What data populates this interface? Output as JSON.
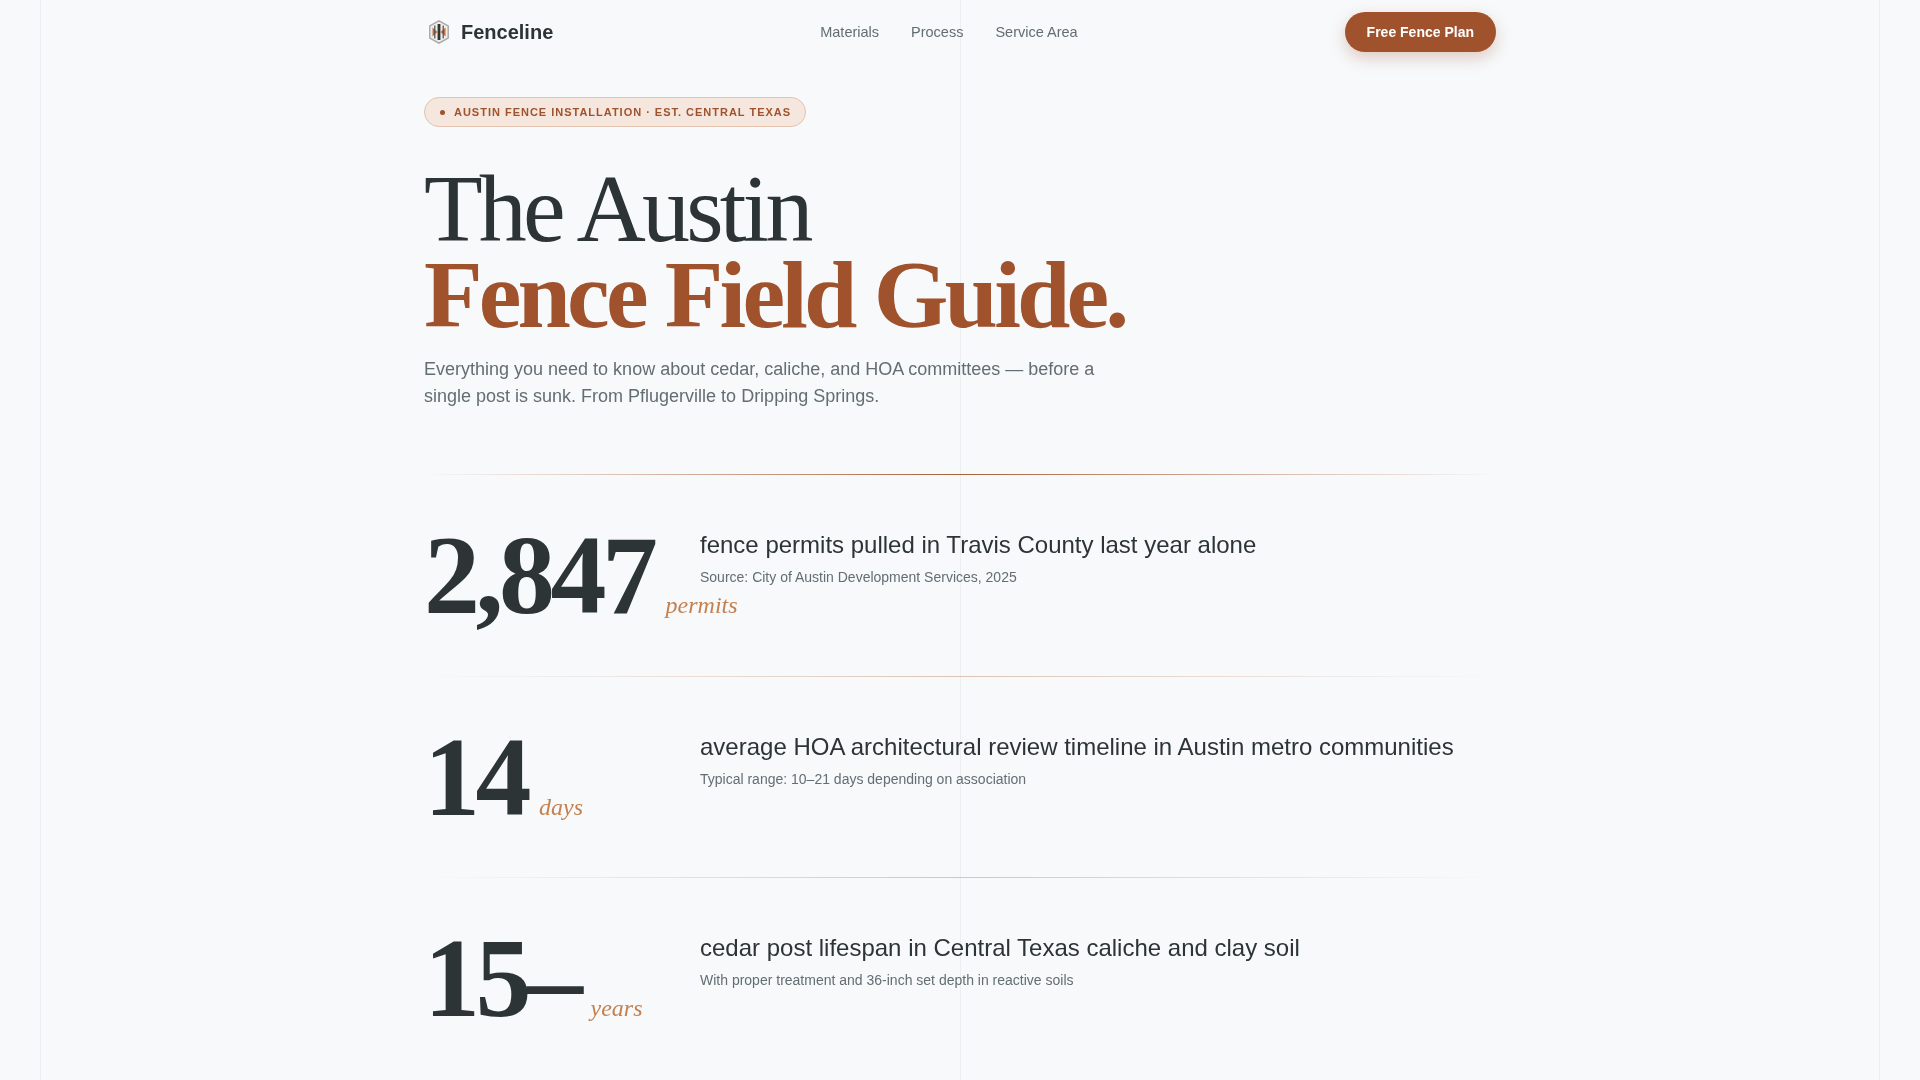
{
  "header": {
    "brand": "Fenceline",
    "nav": [
      "Materials",
      "Process",
      "Service Area"
    ],
    "cta": "Free Fence Plan"
  },
  "hero": {
    "badge": "AUSTIN FENCE INSTALLATION · EST. CENTRAL TEXAS",
    "title_line_1": "The Austin",
    "title_line_2": "Fence Field Guide.",
    "intro": "Everything you need to know about cedar, caliche, and HOA committees — before a single post is sunk. From Pflugerville to Dripping Springs."
  },
  "stats": [
    {
      "value": "2,847",
      "unit": "permits",
      "title": "fence permits pulled in Travis County last year alone",
      "note": "Source: City of Austin Development Services, 2025"
    },
    {
      "value": "14",
      "unit": "days",
      "title": "average HOA architectural review timeline in Austin metro communities",
      "note": "Typical range: 10–21 days depending on association"
    },
    {
      "value": "15–",
      "unit": "years",
      "title": "cedar post lifespan in Central Texas caliche and clay soil",
      "note": "With proper treatment and 36-inch set depth in reactive soils"
    }
  ]
}
